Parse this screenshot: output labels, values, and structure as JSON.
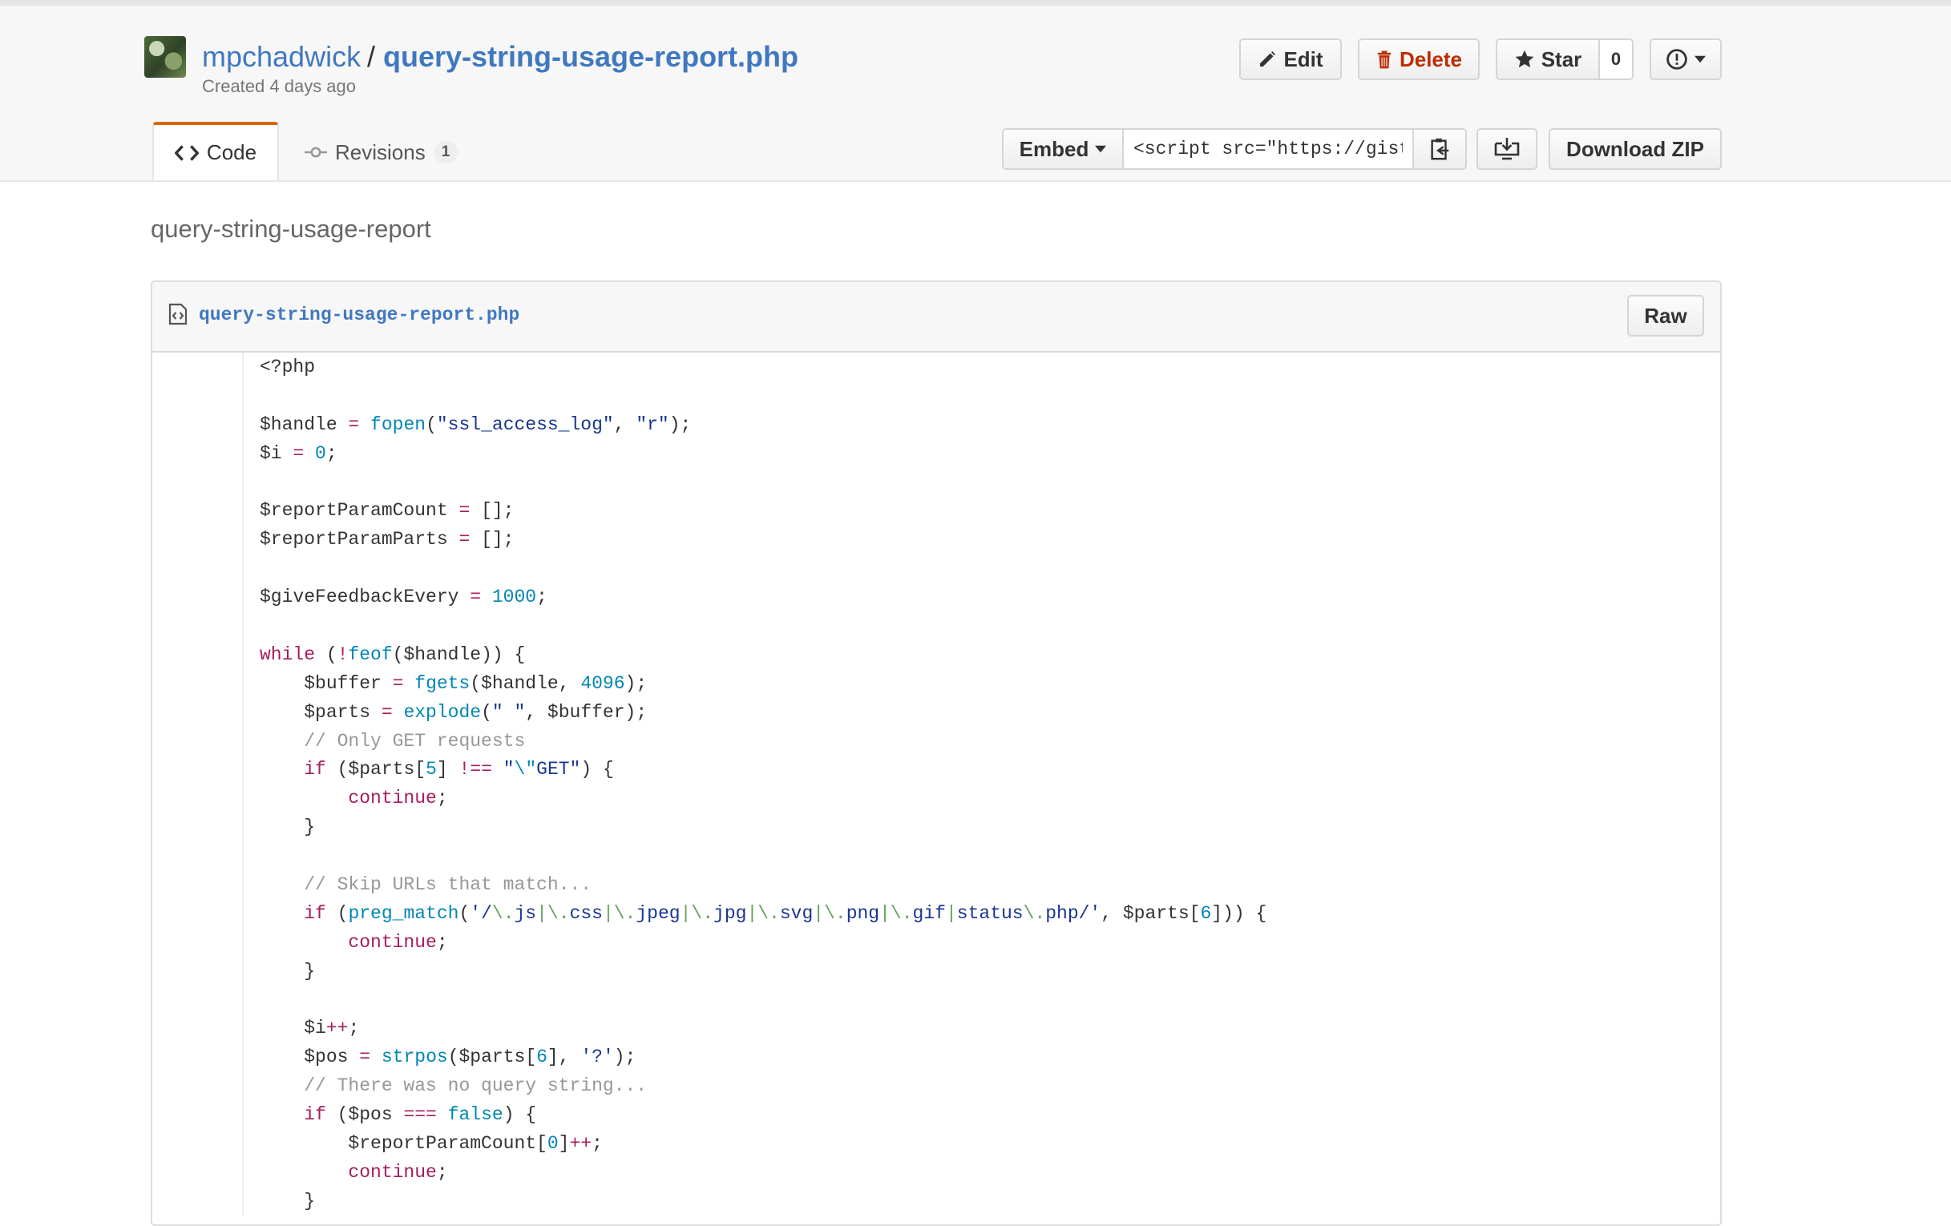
{
  "gist": {
    "owner": "mpchadwick",
    "separator": "/",
    "name": "query-string-usage-report.php",
    "created": "Created 4 days ago",
    "description": "query-string-usage-report"
  },
  "actions": {
    "edit": "Edit",
    "delete": "Delete",
    "star": "Star",
    "star_count": "0"
  },
  "tabs": {
    "code": "Code",
    "revisions": "Revisions",
    "revisions_count": "1"
  },
  "toolbar": {
    "embed_label": "Embed",
    "embed_value": "<script src=\"https://gist",
    "download_zip": "Download ZIP"
  },
  "file": {
    "name": "query-string-usage-report.php",
    "raw_label": "Raw",
    "lines": [
      [
        [
          "",
          "<?php"
        ]
      ],
      [],
      [
        [
          "",
          "$handle "
        ],
        [
          "op",
          "="
        ],
        [
          "",
          " "
        ],
        [
          "fn",
          "fopen"
        ],
        [
          "",
          "("
        ],
        [
          "str",
          "\"ssl_access_log\""
        ],
        [
          "",
          ", "
        ],
        [
          "str",
          "\"r\""
        ],
        [
          "",
          ");"
        ]
      ],
      [
        [
          "",
          "$i "
        ],
        [
          "op",
          "="
        ],
        [
          "",
          " "
        ],
        [
          "num",
          "0"
        ],
        [
          "",
          ";"
        ]
      ],
      [],
      [
        [
          "",
          "$reportParamCount "
        ],
        [
          "op",
          "="
        ],
        [
          "",
          " [];"
        ]
      ],
      [
        [
          "",
          "$reportParamParts "
        ],
        [
          "op",
          "="
        ],
        [
          "",
          " [];"
        ]
      ],
      [],
      [
        [
          "",
          "$giveFeedbackEvery "
        ],
        [
          "op",
          "="
        ],
        [
          "",
          " "
        ],
        [
          "num",
          "1000"
        ],
        [
          "",
          ";"
        ]
      ],
      [],
      [
        [
          "kw",
          "while"
        ],
        [
          "",
          " ("
        ],
        [
          "op",
          "!"
        ],
        [
          "fn",
          "feof"
        ],
        [
          "",
          "($handle)) {"
        ]
      ],
      [
        [
          "",
          "    $buffer "
        ],
        [
          "op",
          "="
        ],
        [
          "",
          " "
        ],
        [
          "fn",
          "fgets"
        ],
        [
          "",
          "($handle, "
        ],
        [
          "num",
          "4096"
        ],
        [
          "",
          ");"
        ]
      ],
      [
        [
          "",
          "    $parts "
        ],
        [
          "op",
          "="
        ],
        [
          "",
          " "
        ],
        [
          "fn",
          "explode"
        ],
        [
          "",
          "("
        ],
        [
          "str",
          "\" \""
        ],
        [
          "",
          ", $buffer);"
        ]
      ],
      [
        [
          "com",
          "    // Only GET requests"
        ]
      ],
      [
        [
          "kw",
          "    if"
        ],
        [
          "",
          " ($parts["
        ],
        [
          "num",
          "5"
        ],
        [
          "",
          "] "
        ],
        [
          "op",
          "!=="
        ],
        [
          "",
          " "
        ],
        [
          "str",
          "\""
        ],
        [
          "esc",
          "\\\""
        ],
        [
          "str",
          "GET\""
        ],
        [
          "",
          ") {"
        ]
      ],
      [
        [
          "kw",
          "        continue"
        ],
        [
          "",
          ";"
        ]
      ],
      [
        [
          "",
          "    }"
        ]
      ],
      [],
      [
        [
          "com",
          "    // Skip URLs that match..."
        ]
      ],
      [
        [
          "kw",
          "    if"
        ],
        [
          "",
          " ("
        ],
        [
          "fn",
          "preg_match"
        ],
        [
          "",
          "("
        ],
        [
          "str",
          "'/"
        ],
        [
          "rx",
          "\\."
        ],
        [
          "str",
          "js"
        ],
        [
          "rx",
          "|\\."
        ],
        [
          "str",
          "css"
        ],
        [
          "rx",
          "|\\."
        ],
        [
          "str",
          "jpeg"
        ],
        [
          "rx",
          "|\\."
        ],
        [
          "str",
          "jpg"
        ],
        [
          "rx",
          "|\\."
        ],
        [
          "str",
          "svg"
        ],
        [
          "rx",
          "|\\."
        ],
        [
          "str",
          "png"
        ],
        [
          "rx",
          "|\\."
        ],
        [
          "str",
          "gif"
        ],
        [
          "rx",
          "|"
        ],
        [
          "str",
          "status"
        ],
        [
          "rx",
          "\\."
        ],
        [
          "str",
          "php/'"
        ],
        [
          "",
          ", $parts["
        ],
        [
          "num",
          "6"
        ],
        [
          "",
          "])) {"
        ]
      ],
      [
        [
          "kw",
          "        continue"
        ],
        [
          "",
          ";"
        ]
      ],
      [
        [
          "",
          "    }"
        ]
      ],
      [],
      [
        [
          "",
          "    $i"
        ],
        [
          "op",
          "++"
        ],
        [
          "",
          ";"
        ]
      ],
      [
        [
          "",
          "    $pos "
        ],
        [
          "op",
          "="
        ],
        [
          "",
          " "
        ],
        [
          "fn",
          "strpos"
        ],
        [
          "",
          "($parts["
        ],
        [
          "num",
          "6"
        ],
        [
          "",
          "], "
        ],
        [
          "str",
          "'?'"
        ],
        [
          "",
          ");"
        ]
      ],
      [
        [
          "com",
          "    // There was no query string..."
        ]
      ],
      [
        [
          "kw",
          "    if"
        ],
        [
          "",
          " ($pos "
        ],
        [
          "op",
          "==="
        ],
        [
          "",
          " "
        ],
        [
          "num",
          "false"
        ],
        [
          "",
          ") {"
        ]
      ],
      [
        [
          "",
          "        $reportParamCount["
        ],
        [
          "num",
          "0"
        ],
        [
          "",
          "]"
        ],
        [
          "op",
          "++"
        ],
        [
          "",
          ";"
        ]
      ],
      [
        [
          "kw",
          "        continue"
        ],
        [
          "",
          ";"
        ]
      ],
      [
        [
          "",
          "    }"
        ]
      ]
    ]
  },
  "icons": {
    "edit": "pencil-icon",
    "delete": "trash-icon",
    "star": "star-icon",
    "report": "alert-icon",
    "code": "code-icon",
    "revisions": "git-commit-icon",
    "copy": "clippy-icon",
    "clone": "desktop-download-icon",
    "file": "file-code-icon"
  },
  "colors": {
    "link": "#4078c0",
    "delete": "#bd2c00",
    "tab_accent": "#d26911",
    "keyword": "#a71d5d",
    "function": "#0086b3",
    "string": "#183691",
    "comment": "#969896",
    "regex": "#63a35c"
  }
}
